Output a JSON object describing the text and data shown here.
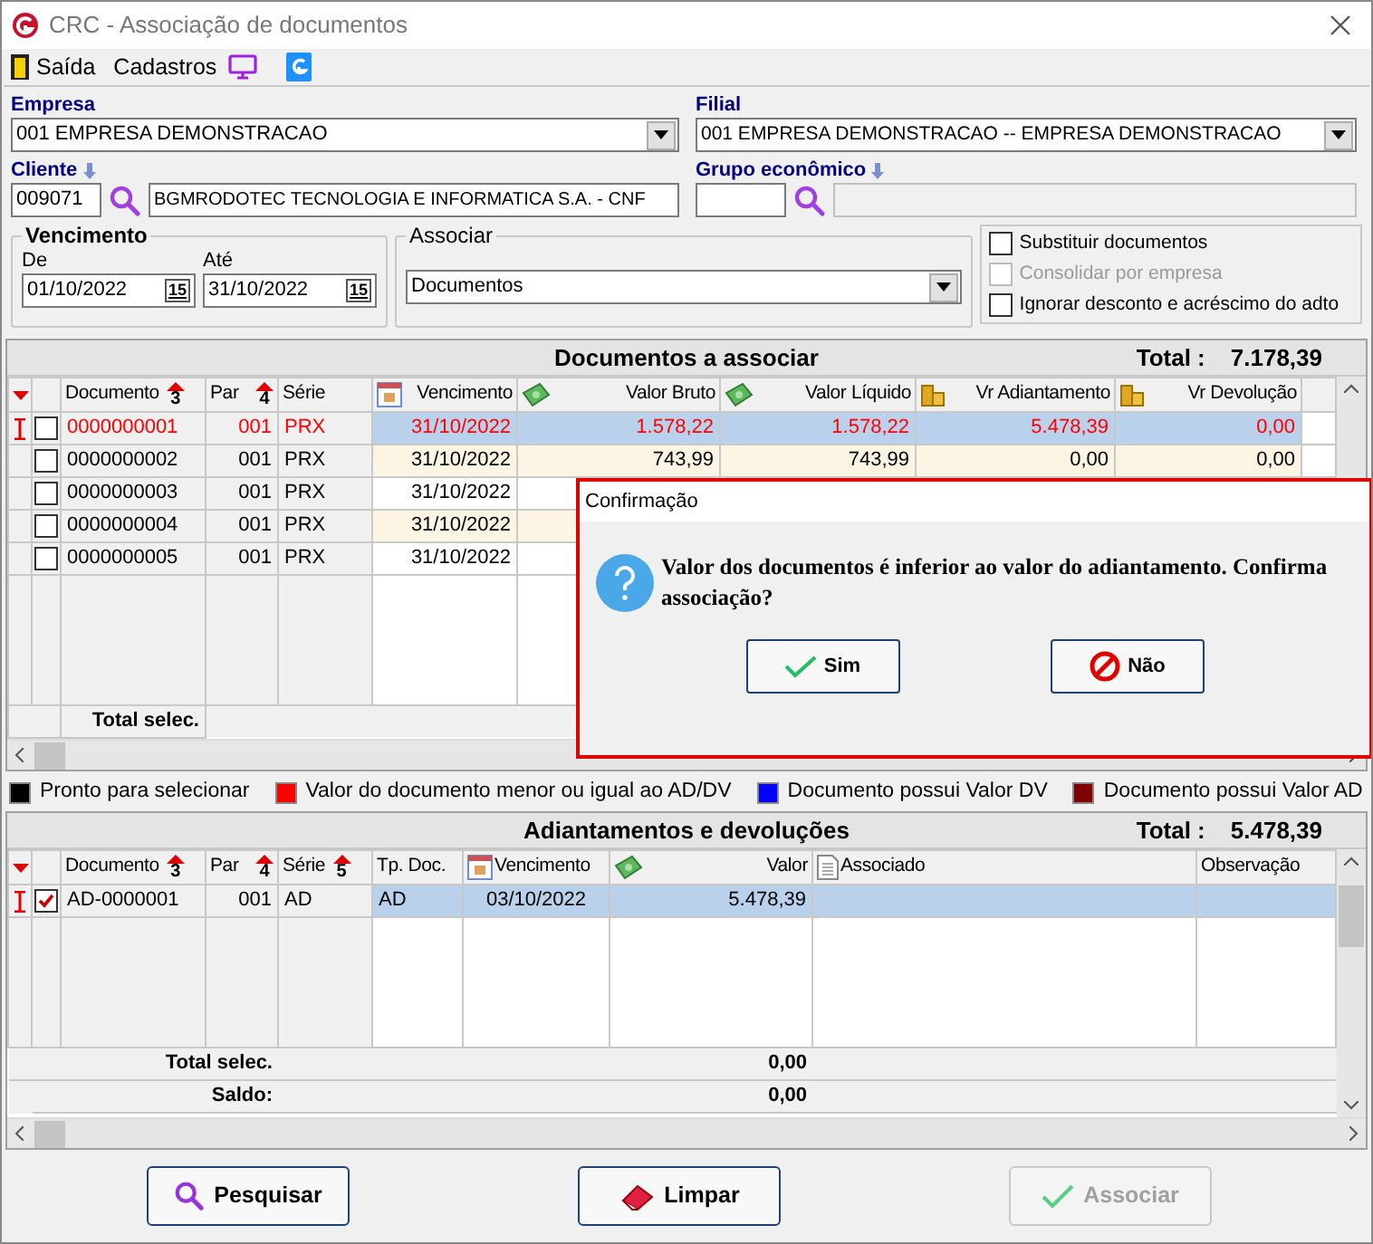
{
  "window": {
    "title": "CRC - Associação de documentos"
  },
  "menu": [
    {
      "label": "Saída"
    },
    {
      "label": "Cadastros"
    }
  ],
  "empresa": {
    "label": "Empresa",
    "value": "001 EMPRESA DEMONSTRACAO"
  },
  "filial": {
    "label": "Filial",
    "value": "001 EMPRESA DEMONSTRACAO -- EMPRESA DEMONSTRACAO"
  },
  "cliente": {
    "label": "Cliente",
    "code": "009071",
    "name": "BGMRODOTEC TECNOLOGIA E INFORMATICA S.A. - CNF"
  },
  "grupo": {
    "label": "Grupo econômico"
  },
  "vencimento": {
    "label": "Vencimento",
    "from_label": "De",
    "from": "01/10/2022",
    "to_label": "Até",
    "to": "31/10/2022",
    "from_glyph": "15",
    "to_glyph": "15"
  },
  "associar": {
    "label": "Associar",
    "value": "Documentos"
  },
  "options": [
    {
      "label": "Substituir documentos",
      "checked": false,
      "disabled": false
    },
    {
      "label": "Consolidar por empresa",
      "checked": false,
      "disabled": true
    },
    {
      "label": "Ignorar desconto e acréscimo do adto",
      "checked": false,
      "disabled": false
    }
  ],
  "documentos": {
    "title": "Documentos a associar",
    "total_label": "Total :",
    "total": "7.178,39",
    "columns": [
      {
        "label": "Documento",
        "sort": "3"
      },
      {
        "label": "Par",
        "sort": "4"
      },
      {
        "label": "Série"
      },
      {
        "label": "Vencimento"
      },
      {
        "label": "Valor Bruto"
      },
      {
        "label": "Valor Líquido"
      },
      {
        "label": "Vr Adiantamento"
      },
      {
        "label": "Vr Devolução"
      }
    ],
    "rows": [
      {
        "selected": true,
        "checked": false,
        "color": "#ff0000",
        "cells": [
          "0000000001",
          "001",
          "PRX",
          "31/10/2022",
          "1.578,22",
          "1.578,22",
          "5.478,39",
          "0,00"
        ]
      },
      {
        "selected": false,
        "checked": false,
        "color": "#000000",
        "cells": [
          "0000000002",
          "001",
          "PRX",
          "31/10/2022",
          "743,99",
          "743,99",
          "0,00",
          "0,00"
        ]
      },
      {
        "selected": false,
        "checked": false,
        "color": "#000000",
        "cells": [
          "0000000003",
          "001",
          "PRX",
          "31/10/2022"
        ]
      },
      {
        "selected": false,
        "checked": false,
        "color": "#000000",
        "cells": [
          "0000000004",
          "001",
          "PRX",
          "31/10/2022"
        ]
      },
      {
        "selected": false,
        "checked": false,
        "color": "#000000",
        "cells": [
          "0000000005",
          "001",
          "PRX",
          "31/10/2022"
        ]
      }
    ],
    "total_selec_label": "Total selec."
  },
  "legend": [
    {
      "color": "#000000",
      "label": "Pronto para selecionar"
    },
    {
      "color": "#ff0000",
      "label": "Valor do documento menor ou igual ao AD/DV"
    },
    {
      "color": "#0000ff",
      "label": "Documento possui Valor DV"
    },
    {
      "color": "#800000",
      "label": "Documento possui Valor AD"
    }
  ],
  "adiantamentos": {
    "title": "Adiantamentos e devoluções",
    "total_label": "Total :",
    "total": "5.478,39",
    "columns": [
      {
        "label": "Documento",
        "sort": "3"
      },
      {
        "label": "Par",
        "sort": "4"
      },
      {
        "label": "Série",
        "sort": "5"
      },
      {
        "label": "Tp. Doc."
      },
      {
        "label": "Vencimento"
      },
      {
        "label": "Valor"
      },
      {
        "label": "Associado"
      },
      {
        "label": "Observação"
      }
    ],
    "rows": [
      {
        "selected": true,
        "checked": true,
        "cells": [
          "AD-0000001",
          "001",
          "AD",
          "AD",
          "03/10/2022",
          "5.478,39",
          "",
          ""
        ]
      }
    ],
    "total_selec_label": "Total selec.",
    "total_selec": "0,00",
    "saldo_label": "Saldo:",
    "saldo": "0,00"
  },
  "buttons": [
    {
      "label": "Pesquisar",
      "disabled": false
    },
    {
      "label": "Limpar",
      "disabled": false
    },
    {
      "label": "Associar",
      "disabled": true
    }
  ],
  "dialog": {
    "title": "Confirmação",
    "message": "Valor dos documentos é inferior ao valor do adiantamento. Confirma associação?",
    "buttons": [
      {
        "label": "Sim"
      },
      {
        "label": "Não"
      }
    ]
  }
}
